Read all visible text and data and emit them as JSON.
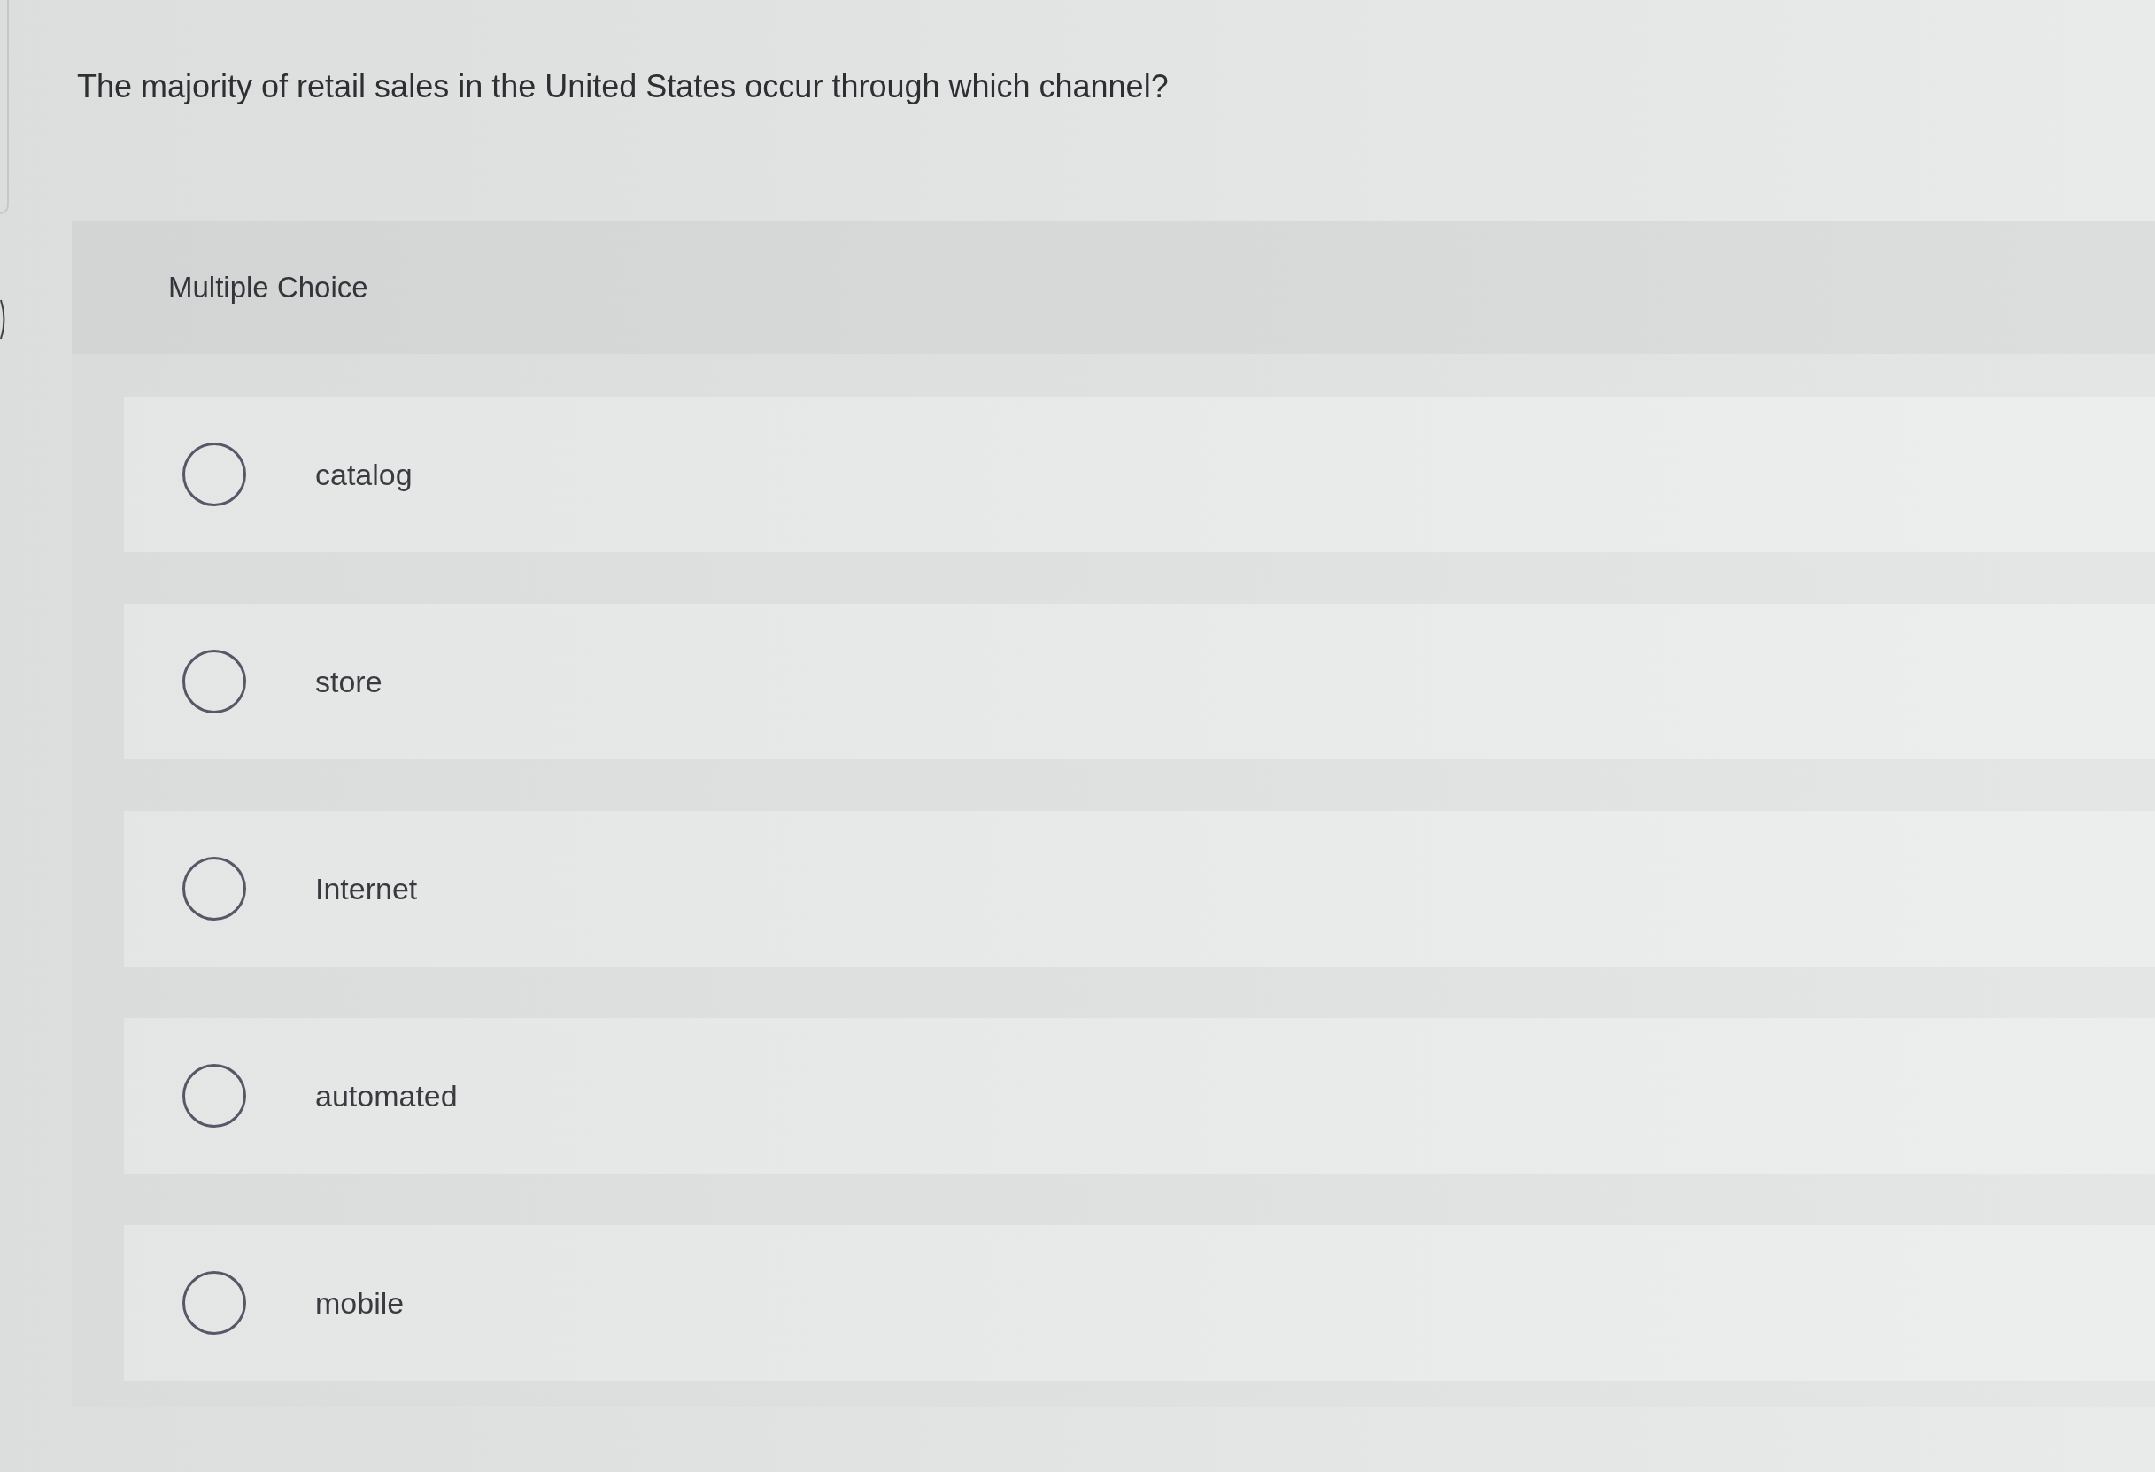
{
  "question": {
    "text": "The majority of retail sales in the United States occur through which channel?"
  },
  "answer_panel": {
    "title": "Multiple Choice",
    "options": [
      {
        "label": "catalog",
        "selected": false
      },
      {
        "label": "store",
        "selected": false
      },
      {
        "label": "Internet",
        "selected": false
      },
      {
        "label": "automated",
        "selected": false
      },
      {
        "label": "mobile",
        "selected": false
      }
    ]
  }
}
